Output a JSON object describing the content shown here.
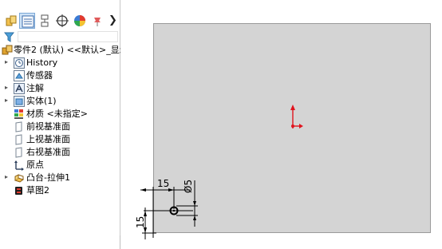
{
  "tabs": {
    "chevron": "❯",
    "items": [
      {
        "name": "featuremanager-tab",
        "icon": "assembly-icon"
      },
      {
        "name": "propertymanager-tab",
        "icon": "property-list-icon"
      },
      {
        "name": "configurationmanager-tab",
        "icon": "configuration-icon"
      },
      {
        "name": "dimxpert-tab",
        "icon": "crosshair-icon"
      },
      {
        "name": "appearance-tab",
        "icon": "appearance-ball-icon"
      },
      {
        "name": "extra-tab",
        "icon": "pushpin-icon"
      }
    ]
  },
  "filter": {
    "icon": "filter-icon",
    "value": ""
  },
  "tree": {
    "root": {
      "label": "零件2 (默认) <<默认>_显示状",
      "icon": "part-icon"
    },
    "items": [
      {
        "label": "History",
        "icon": "history-icon",
        "expandable": true
      },
      {
        "label": "传感器",
        "icon": "sensor-icon",
        "expandable": false
      },
      {
        "label": "注解",
        "icon": "annotation-icon",
        "expandable": true
      },
      {
        "label": "实体(1)",
        "icon": "solid-body-icon",
        "expandable": true
      },
      {
        "label": "材质 <未指定>",
        "icon": "material-icon",
        "expandable": false
      },
      {
        "label": "前视基准面",
        "icon": "plane-icon",
        "expandable": false
      },
      {
        "label": "上视基准面",
        "icon": "plane-icon",
        "expandable": false
      },
      {
        "label": "右视基准面",
        "icon": "plane-icon",
        "expandable": false
      },
      {
        "label": "原点",
        "icon": "origin-icon",
        "expandable": false
      },
      {
        "label": "凸台-拉伸1",
        "icon": "extrude-icon",
        "expandable": true
      },
      {
        "label": "草图2",
        "icon": "sketch-icon",
        "expandable": false
      }
    ]
  },
  "sketch": {
    "dim_horizontal": "15",
    "dim_vertical": "15",
    "dim_diameter": "Ø5",
    "colors": {
      "sheet": "#d4d4d4",
      "origin": "#e0141e",
      "dimension": "#000000"
    }
  }
}
